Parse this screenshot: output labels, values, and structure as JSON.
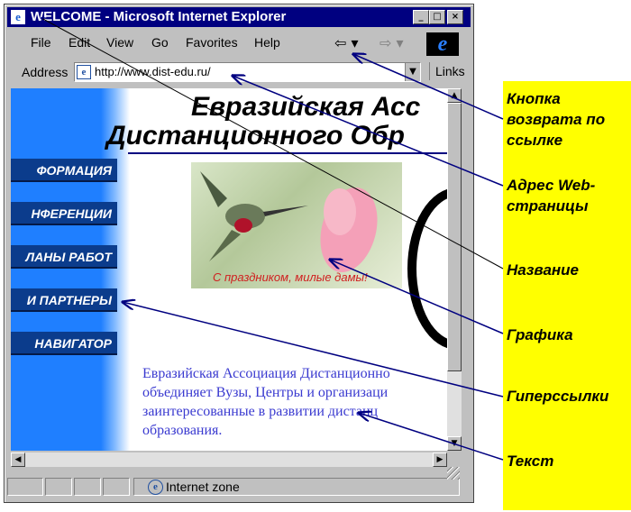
{
  "window": {
    "title": "WELCOME - Microsoft Internet Explorer",
    "controls": {
      "minimize": "_",
      "maximize": "□",
      "close": "×"
    },
    "menu": [
      "File",
      "Edit",
      "View",
      "Go",
      "Favorites",
      "Help"
    ],
    "nav": {
      "back": "⇦ ▾",
      "forward": "⇨ ▾",
      "logo": "e"
    },
    "address": {
      "label": "Address",
      "value": "http://www.dist-edu.ru/",
      "links": "Links"
    },
    "status": "Internet zone"
  },
  "page": {
    "heading_line1": "Евразийская Асс",
    "heading_line2": "Дистанционного Обр",
    "nav_buttons": [
      "ФОРМАЦИЯ",
      "НФЕРЕНЦИИ",
      "ЛАНЫ РАБОТ",
      "И ПАРТНЕРЫ",
      "НАВИГАТОР"
    ],
    "photo_caption": "С праздником, милые дамы!",
    "body_text": [
      "Евразийская Ассоциация Дистанционно",
      "объединяет Вузы, Центры и организаци",
      "заинтересованные в развитии дистанц",
      "образования."
    ]
  },
  "annotations": [
    {
      "text": "Кнопка возврата по ссылке"
    },
    {
      "text": "Адрес Web-страницы"
    },
    {
      "text": "Название"
    },
    {
      "text": "Графика"
    },
    {
      "text": "Гиперссылки"
    },
    {
      "text": "Текст"
    }
  ],
  "colors": {
    "titlebar": "#000080",
    "sidebar": "#1f7fff",
    "annotation_panel": "#ffff00",
    "arrow": "#000080",
    "body_text": "#3a3ad0"
  }
}
